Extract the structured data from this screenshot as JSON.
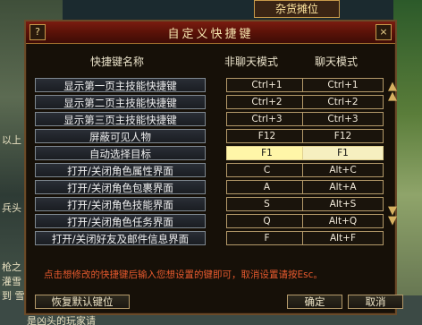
{
  "background": {
    "shop_sign": "杂货摊位",
    "fragments": [
      "以上",
      "兵头",
      "枪之",
      "灌雪",
      "到 雪",
      "是凶头的玩家请"
    ]
  },
  "dialog": {
    "title": "自定义快捷键",
    "help_button": "?",
    "close_button": "×",
    "columns": {
      "name": "快捷键名称",
      "normal": "非聊天模式",
      "chat": "聊天模式"
    },
    "rows": [
      {
        "name": "显示第一页主技能快捷键",
        "normal": "Ctrl+1",
        "chat": "Ctrl+1"
      },
      {
        "name": "显示第二页主技能快捷键",
        "normal": "Ctrl+2",
        "chat": "Ctrl+2"
      },
      {
        "name": "显示第三页主技能快捷键",
        "normal": "Ctrl+3",
        "chat": "Ctrl+3"
      },
      {
        "name": "屏蔽可见人物",
        "normal": "F12",
        "chat": "F12"
      },
      {
        "name": "自动选择目标",
        "normal": "F1",
        "chat": "F1"
      },
      {
        "name": "打开/关闭角色属性界面",
        "normal": "C",
        "chat": "Alt+C"
      },
      {
        "name": "打开/关闭角色包裹界面",
        "normal": "A",
        "chat": "Alt+A"
      },
      {
        "name": "打开/关闭角色技能界面",
        "normal": "S",
        "chat": "Alt+S"
      },
      {
        "name": "打开/关闭角色任务界面",
        "normal": "Q",
        "chat": "Alt+Q"
      },
      {
        "name": "打开/关闭好友及邮件信息界面",
        "normal": "F",
        "chat": "Alt+F"
      }
    ],
    "hint": "点击想修改的快捷键后输入您想设置的键即可，取消设置请按Esc。",
    "buttons": {
      "restore": "恢复默认键位",
      "ok": "确定",
      "cancel": "取消"
    },
    "colors": {
      "title_bar": "#5a1208",
      "hint": "#e85a2e",
      "selected_key": "#fff6a8"
    }
  }
}
